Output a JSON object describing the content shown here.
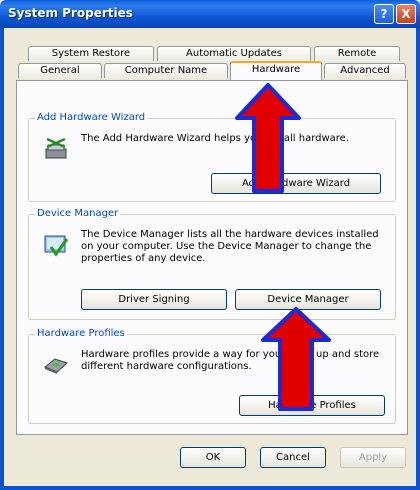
{
  "window": {
    "title": "System Properties",
    "help_glyph": "?",
    "close_glyph": "X"
  },
  "tabs": {
    "row1": [
      "System Restore",
      "Automatic Updates",
      "Remote"
    ],
    "row2": [
      "General",
      "Computer Name",
      "Hardware",
      "Advanced"
    ],
    "active": "Hardware"
  },
  "groups": {
    "add_hardware": {
      "label": "Add Hardware Wizard",
      "description": "The Add Hardware Wizard helps you install hardware.",
      "button": "Add Hardware Wizard",
      "icon": "add-hardware-icon"
    },
    "device_manager": {
      "label": "Device Manager",
      "description": "The Device Manager lists all the hardware devices installed on your computer. Use the Device Manager to change the properties of any device.",
      "buttons": [
        "Driver Signing",
        "Device Manager"
      ],
      "icon": "device-manager-icon"
    },
    "hardware_profiles": {
      "label": "Hardware Profiles",
      "description": "Hardware profiles provide a way for you to set up and store different hardware configurations.",
      "button": "Hardware Profiles",
      "icon": "hardware-profiles-icon"
    }
  },
  "footer": {
    "ok": "OK",
    "cancel": "Cancel",
    "apply": "Apply"
  },
  "annotations": {
    "arrow_color": "#e00000",
    "arrow_outline": "#1a2bd8"
  }
}
